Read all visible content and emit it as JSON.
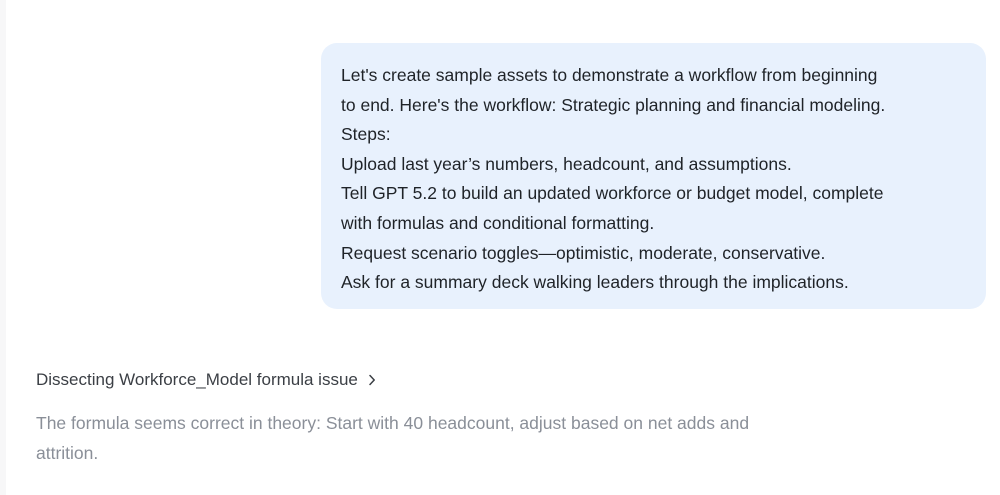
{
  "user_message": {
    "lines": [
      "Let's create sample assets to demonstrate a workflow from beginning",
      "to end. Here's the workflow: Strategic planning and financial modeling.",
      "Steps:",
      "Upload last year’s numbers, headcount, and assumptions.",
      "Tell GPT 5.2 to build an updated workforce or budget model, complete",
      "with formulas and conditional formatting.",
      "Request scenario toggles—optimistic, moderate, conservative.",
      "Ask for a summary deck walking leaders through the implications."
    ]
  },
  "reasoning": {
    "title": "Dissecting Workforce_Model formula issue",
    "expand_icon": "chevron-right-icon",
    "summary": "The formula seems correct in theory: Start with 40 headcount, adjust based on net adds and attrition."
  },
  "colors": {
    "bubble_background": "#e8f1fd",
    "primary_text": "#1f2328",
    "muted_text": "#8a8f98"
  }
}
